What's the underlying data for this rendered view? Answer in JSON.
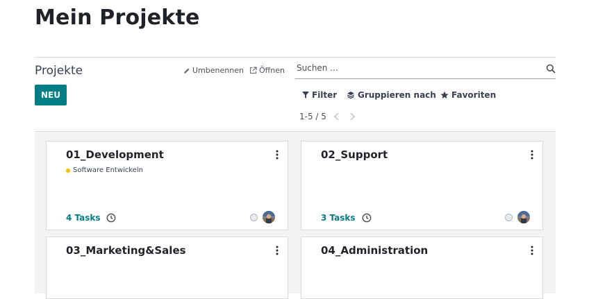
{
  "page": {
    "title": "Mein Projekte"
  },
  "control_panel": {
    "breadcrumb": "Projekte",
    "new_button": "NEU",
    "rename_label": "Umbenennen",
    "open_label": "Öffnen",
    "search_placeholder": "Suchen ...",
    "filter_label": "Filter",
    "group_by_label": "Gruppieren nach",
    "favorites_label": "Favoriten",
    "pager": "1-5 / 5"
  },
  "cards": [
    {
      "title": "01_Development",
      "tag": "Software Entwickeln",
      "tasks": "4 Tasks"
    },
    {
      "title": "02_Support",
      "tasks": "3 Tasks"
    },
    {
      "title": "03_Marketing&Sales"
    },
    {
      "title": "04_Administration"
    }
  ],
  "colors": {
    "accent": "#017e84",
    "tag_dot": "#f3c300",
    "kanban_background": "#f1f3f5"
  }
}
